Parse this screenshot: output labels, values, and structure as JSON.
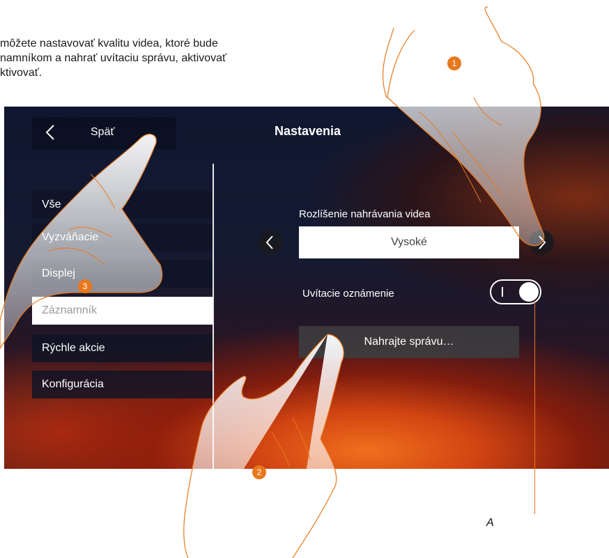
{
  "intro_text": "môžete nastavovať kvalitu videa, ktoré bude\nnamníkom a nahrať uvítaciu správu, aktivovať\nktivovať.",
  "header": {
    "back_label": "Späť",
    "title": "Nastavenia"
  },
  "sidebar": {
    "items": [
      {
        "label": "Vše"
      },
      {
        "label": "Vyzváňacie"
      },
      {
        "label": "Displej"
      },
      {
        "label": "Záznamník",
        "active": true
      },
      {
        "label": "Rýchle akcie"
      },
      {
        "label": "Konfigurácia"
      }
    ]
  },
  "settings": {
    "resolution_label": "Rozlíšenie nahrávania videa",
    "resolution_value": "Vysoké",
    "welcome_label": "Uvítacie oznámenie",
    "welcome_on": true,
    "record_label": "Nahrajte správu…"
  },
  "callouts": [
    "1",
    "2",
    "3"
  ],
  "annotation_letter": "A",
  "colors": {
    "accent": "#e8781d",
    "panel": "#0f1426"
  }
}
